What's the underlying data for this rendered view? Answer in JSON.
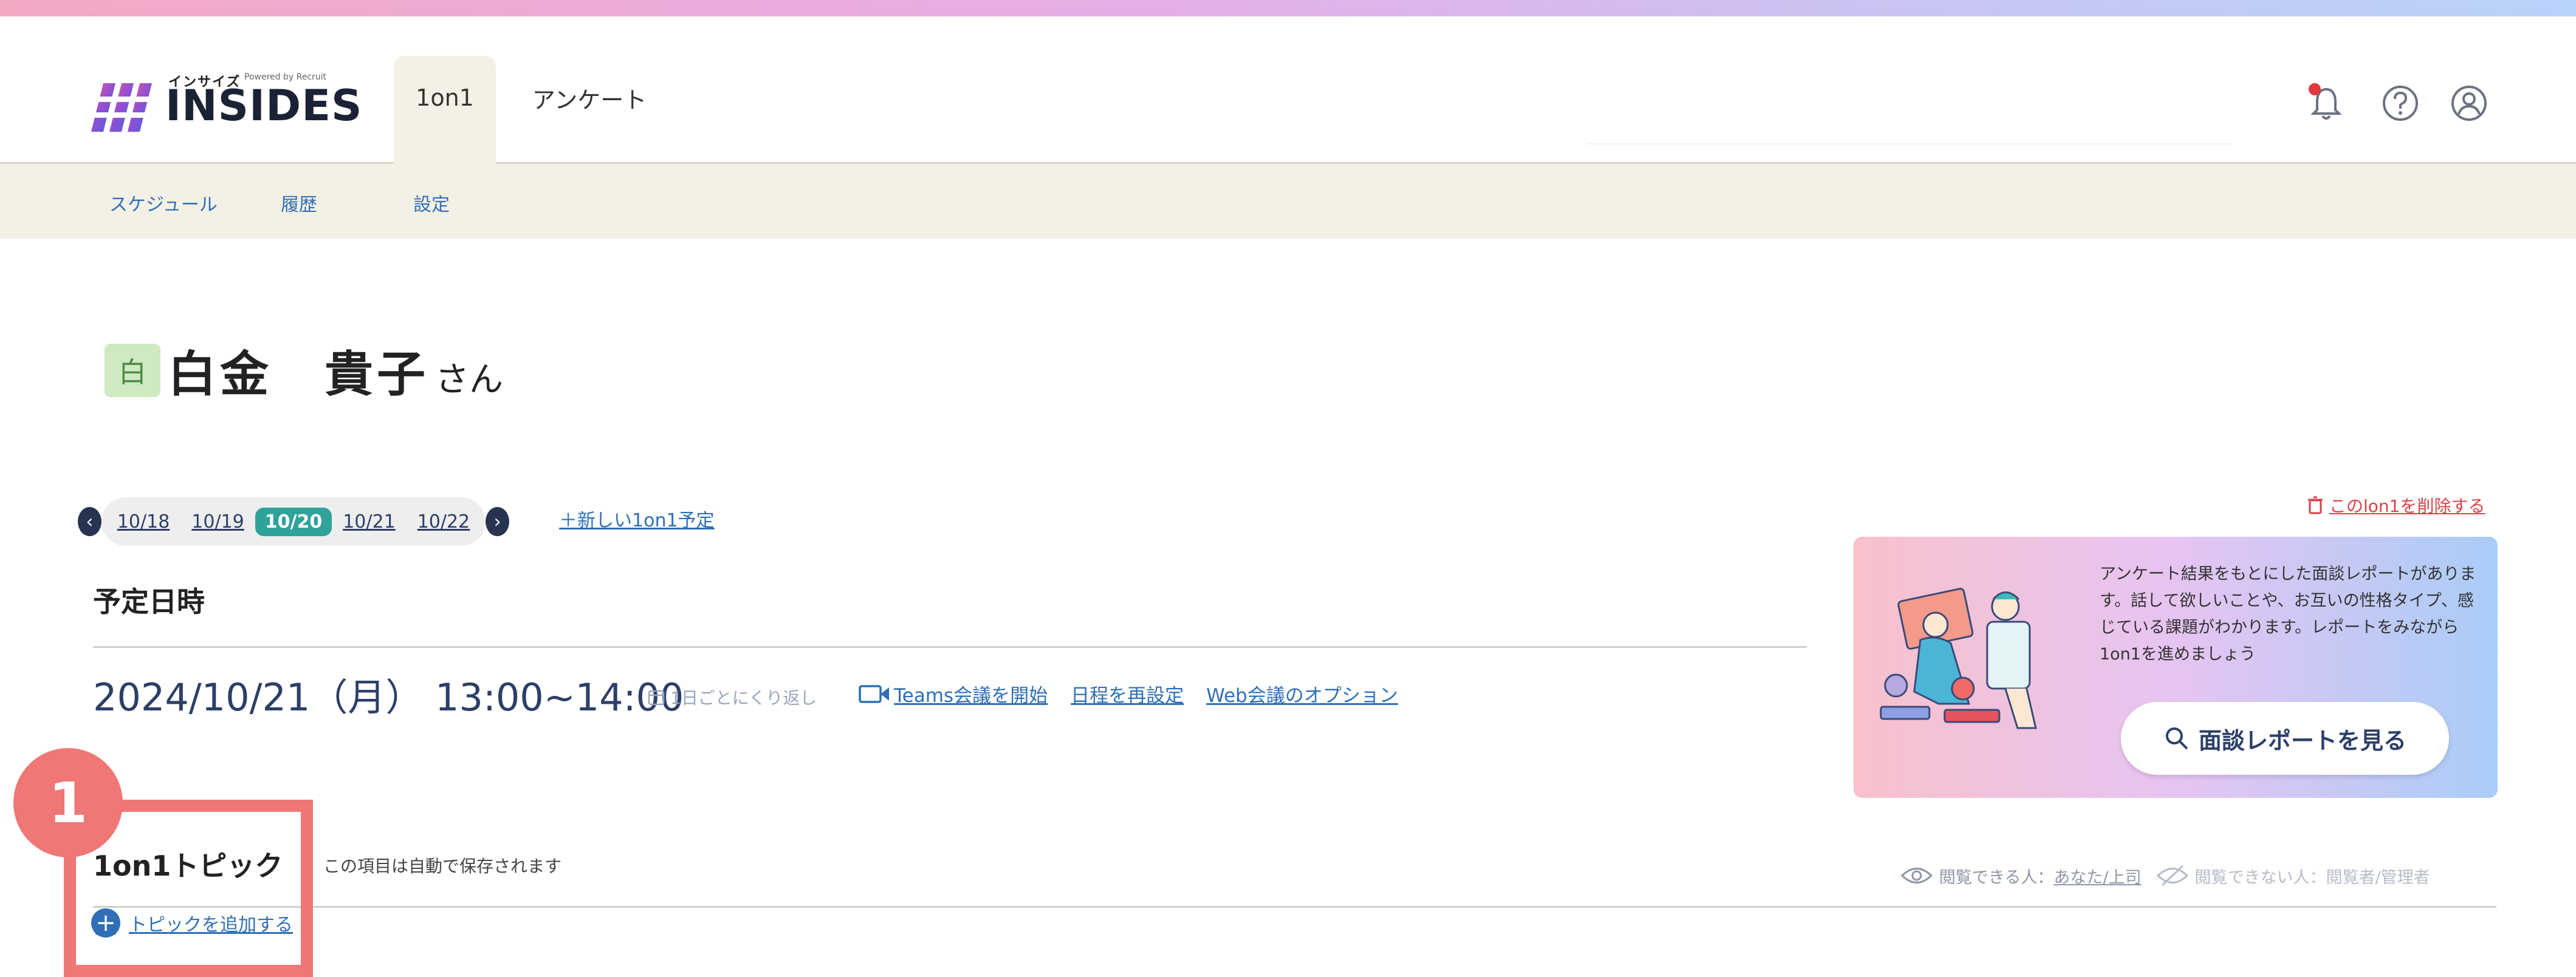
{
  "app": {
    "logo_kana": "インサイズ",
    "logo_powered": "Powered by Recruit",
    "logo_text": "INSIDES"
  },
  "header": {
    "tabs": [
      {
        "label": "1on1",
        "active": true
      },
      {
        "label": "アンケート",
        "active": false
      }
    ],
    "notification_badge_color": "#e0393e"
  },
  "subnav": {
    "items": [
      "スケジュール",
      "履歴",
      "設定"
    ]
  },
  "person": {
    "avatar_char": "白",
    "name": "白金　貴子",
    "suffix": "さん"
  },
  "date_nav": {
    "dates": [
      "10/18",
      "10/19",
      "10/20",
      "10/21",
      "10/22"
    ],
    "active": "10/20",
    "prev_icon": "chevron-left-icon",
    "next_icon": "chevron-right-icon"
  },
  "new_schedule_label": "＋新しい1on1予定",
  "delete_label": "このlon1を削除する",
  "schedule": {
    "section_title": "予定日時",
    "datetime": "2024/10/21（月） 13:00~14:00",
    "repeat_label": "1日ごとにくり返し",
    "teams_label": "Teams会議を開始",
    "reschedule_label": "日程を再設定",
    "web_option_label": "Web会議のオプション"
  },
  "report": {
    "description": "アンケート結果をもとにした面談レポートがあります。話して欲しいことや、お互いの性格タイプ、感じている課題がわかります。レポートをみながら1on1を進めましょう",
    "button_label": "面談レポートを見る"
  },
  "topics": {
    "title": "1on1トピック",
    "autosave_note": "この項目は自動で保存されます",
    "visible_label": "閲覧できる人：",
    "visible_value": "あなた/上司",
    "invisible_label": "閲覧できない人：閲覧者/管理者",
    "add_label": "トピックを追加する"
  },
  "annotation": {
    "number": "1",
    "color": "#ef7775"
  },
  "colors": {
    "accent_teal": "#2fa39a",
    "link_blue": "#2f6fb6",
    "navy": "#263451",
    "subnav_bg": "#f3f1e6"
  }
}
